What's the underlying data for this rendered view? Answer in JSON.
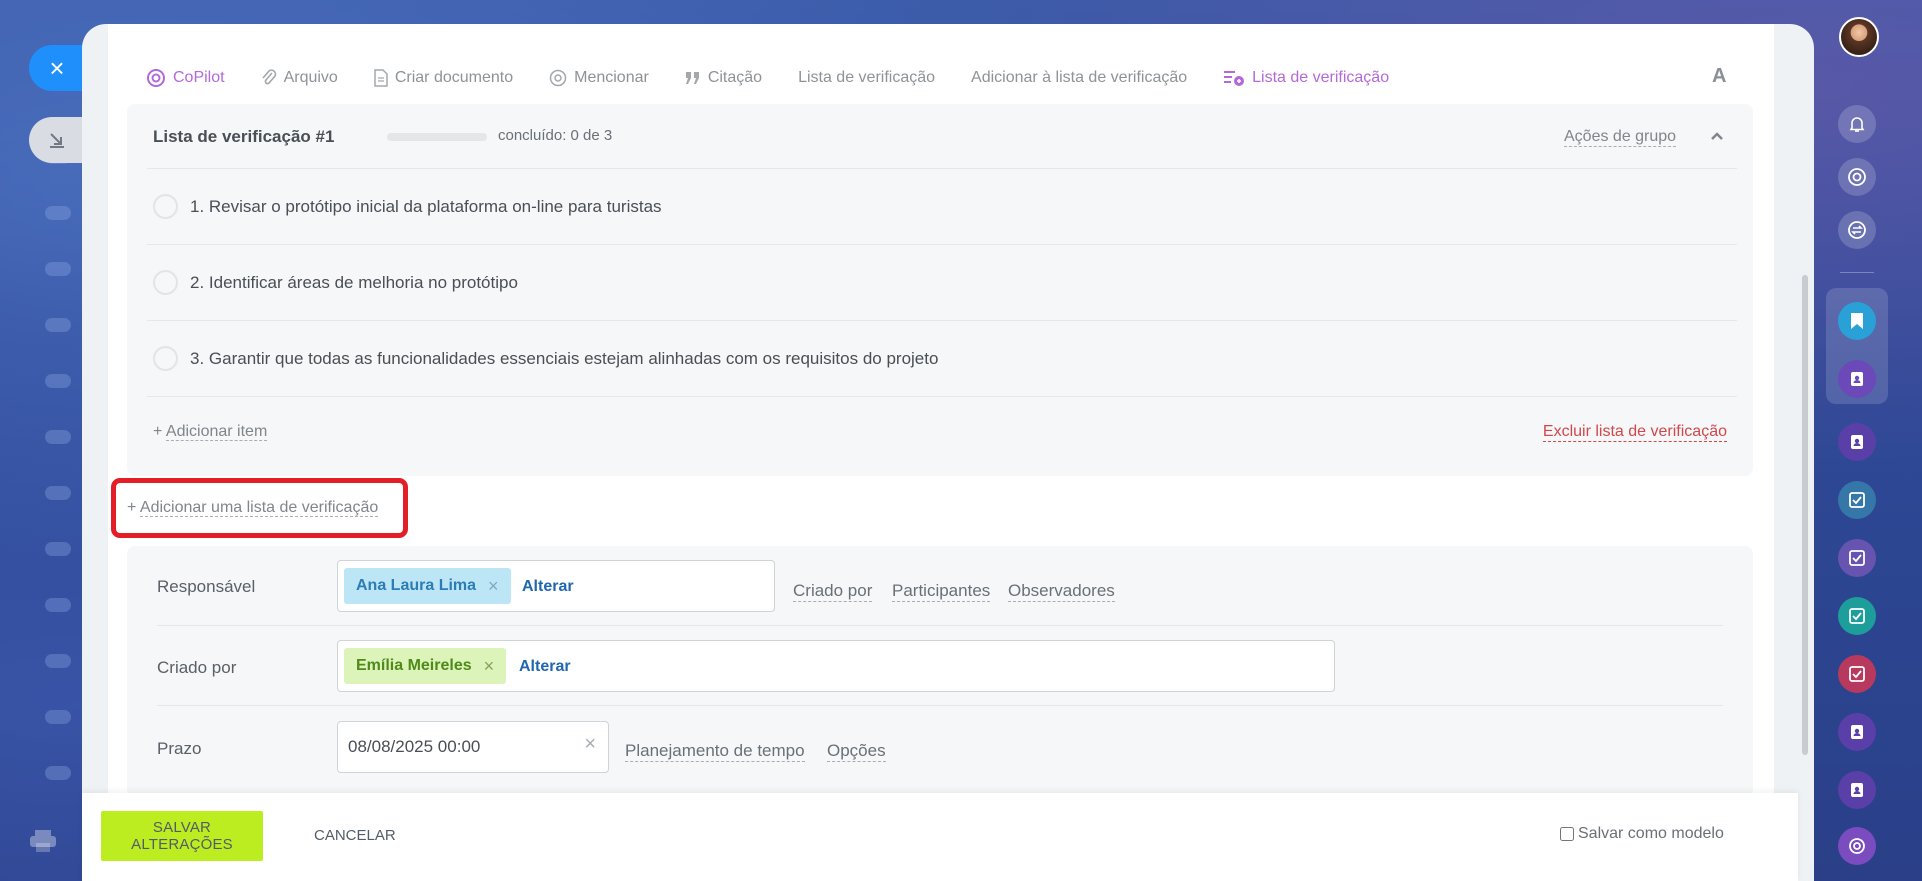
{
  "toolbar": {
    "items": [
      {
        "label": "CoPilot",
        "icon": "copilot-icon"
      },
      {
        "label": "Arquivo",
        "icon": "paperclip-icon"
      },
      {
        "label": "Criar documento",
        "icon": "document-icon"
      },
      {
        "label": "Mencionar",
        "icon": "at-icon"
      },
      {
        "label": "Citação",
        "icon": "quote-icon"
      },
      {
        "label": "Lista de verificação"
      },
      {
        "label": "Adicionar à lista de verificação"
      },
      {
        "label": "Lista de verificação",
        "icon": "checklist-icon"
      }
    ],
    "font_toggle": "A",
    "accent_color": "#b36ad8"
  },
  "checklist": {
    "title": "Lista de verificação #1",
    "progress": {
      "completed": 0,
      "total": 3
    },
    "status": "concluído: 0 de 3",
    "group_actions": "Ações de grupo",
    "items": [
      {
        "text": "1. Revisar o protótipo inicial da plataforma on-line para turistas",
        "checked": false
      },
      {
        "text": "2. Identificar áreas de melhoria no protótipo",
        "checked": false
      },
      {
        "text": "3. Garantir que todas as funcionalidades essenciais estejam alinhadas com os requisitos do projeto",
        "checked": false
      }
    ],
    "add_item_prefix": "+",
    "add_item": "Adicionar item",
    "delete_list": "Excluir lista de verificação"
  },
  "add_list": {
    "prefix": "+",
    "label": "Adicionar uma lista de verificação",
    "highlight_color": "#e41e26"
  },
  "fields": {
    "responsible": {
      "label": "Responsável",
      "chip": "Ana Laura Lima",
      "chip_remove": "×",
      "change": "Alterar",
      "links": [
        "Criado por",
        "Participantes",
        "Observadores"
      ]
    },
    "created_by": {
      "label": "Criado por",
      "chip": "Emília Meireles",
      "chip_remove": "×",
      "change": "Alterar"
    },
    "deadline": {
      "label": "Prazo",
      "value": "08/08/2025 00:00",
      "clear": "×",
      "links": [
        "Planejamento de tempo",
        "Opções"
      ]
    }
  },
  "bottom": {
    "save": "SALVAR ALTERAÇÕES",
    "cancel": "CANCELAR",
    "save_template": "Salvar como modelo",
    "save_color": "#bbed21"
  },
  "left": {
    "close": "×"
  },
  "right_sidebar": {
    "icons": [
      "bell-icon",
      "copilot-icon",
      "sync-icon",
      "bookmark-icon",
      "contact-card-icon",
      "contact-card-icon",
      "task-icon",
      "task-icon",
      "task-icon",
      "task-icon",
      "contact-card-icon",
      "contact-card-icon",
      "copilot-icon"
    ]
  }
}
